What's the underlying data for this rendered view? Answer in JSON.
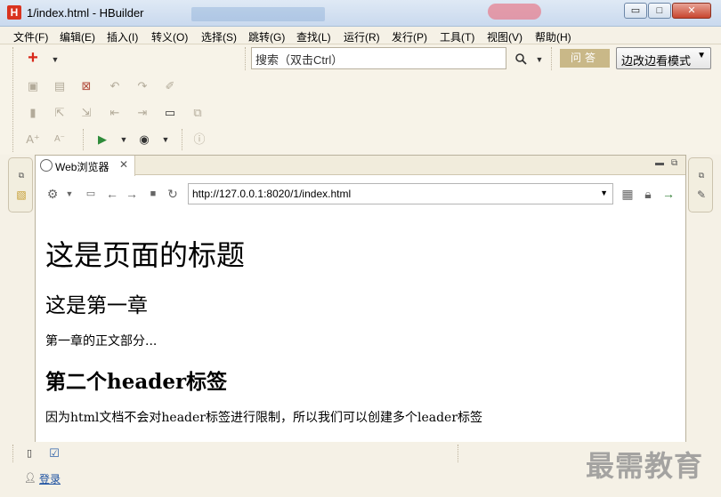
{
  "window": {
    "title": "1/index.html - HBuilder",
    "logo_letter": "H",
    "controls": {
      "minimize": "▭",
      "maximize": "□",
      "close": "✕"
    }
  },
  "menu": [
    "文件(F)",
    "编辑(E)",
    "插入(I)",
    "转义(O)",
    "选择(S)",
    "跳转(G)",
    "查找(L)",
    "运行(R)",
    "发行(P)",
    "工具(T)",
    "视图(V)",
    "帮助(H)"
  ],
  "toolbar": {
    "new_icon": "+",
    "search_placeholder": "搜索（双击Ctrl）",
    "ask_label": "问答",
    "mode_label": "边改边看模式"
  },
  "browser": {
    "tab_label": "Web浏览器",
    "url": "http://127.0.0.1:8020/1/index.html",
    "content": {
      "h1": "这是页面的标题",
      "h2_first": "这是第一章",
      "p_first": "第一章的正文部分...",
      "h2_second": "第二个header标签",
      "p_second": "因为html文档不会对header标签进行限制，所以我们可以创建多个leader标签"
    }
  },
  "footer": {
    "login_label": "登录",
    "watermark": "最需教育"
  }
}
